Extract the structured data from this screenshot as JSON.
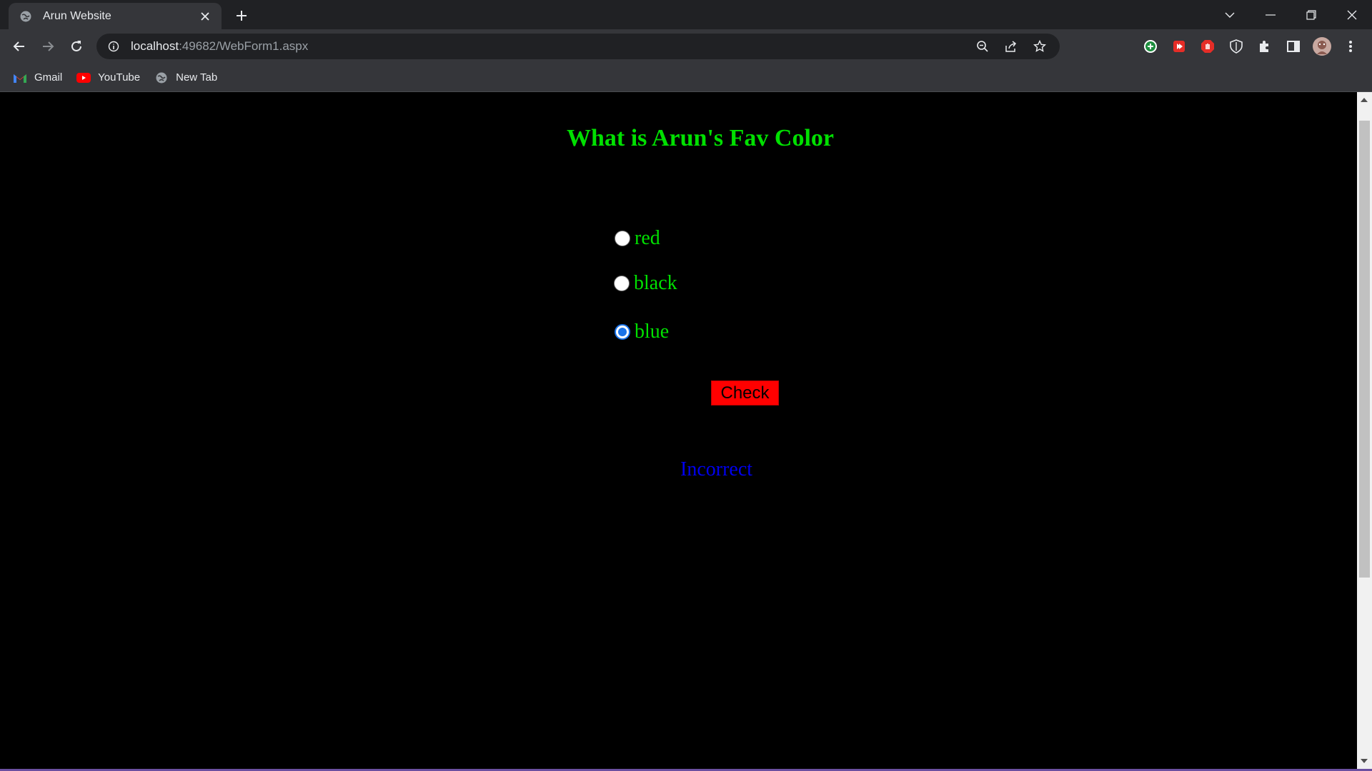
{
  "browser": {
    "tab": {
      "title": "Arun Website"
    },
    "url": {
      "host": "localhost",
      "rest": ":49682/WebForm1.aspx"
    },
    "bookmarks": [
      {
        "label": "Gmail",
        "icon": "gmail-icon"
      },
      {
        "label": "YouTube",
        "icon": "youtube-icon"
      },
      {
        "label": "New Tab",
        "icon": "globe-icon"
      }
    ]
  },
  "page": {
    "title": "What is Arun's Fav Color",
    "options": [
      {
        "label": "red",
        "checked": false
      },
      {
        "label": "black",
        "checked": false
      },
      {
        "label": "blue",
        "checked": true
      }
    ],
    "check_button": "Check",
    "result": "Incorrect"
  },
  "colors": {
    "heading": "#00e000",
    "button_bg": "#ff0000",
    "result": "#0000ee",
    "radio_checked": "#1a73e8"
  }
}
